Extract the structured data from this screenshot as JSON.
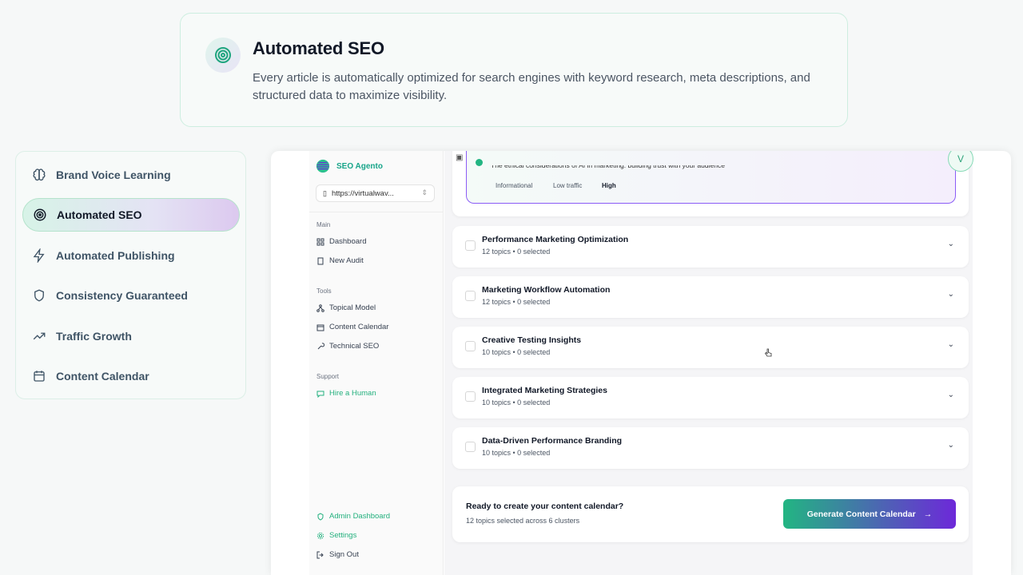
{
  "hero": {
    "title": "Automated SEO",
    "description": "Every article is automatically optimized for search engines with keyword research, meta descriptions, and structured data to maximize visibility.",
    "icon": "target-icon"
  },
  "features": [
    {
      "label": "Brand Voice Learning",
      "icon": "brain-icon",
      "active": false
    },
    {
      "label": "Automated SEO",
      "icon": "target-icon",
      "active": true
    },
    {
      "label": "Automated Publishing",
      "icon": "lightning-icon",
      "active": false
    },
    {
      "label": "Consistency Guaranteed",
      "icon": "shield-icon",
      "active": false
    },
    {
      "label": "Traffic Growth",
      "icon": "trending-up-icon",
      "active": false
    },
    {
      "label": "Content Calendar",
      "icon": "calendar-icon",
      "active": false
    }
  ],
  "app": {
    "brand": "SEO Agento",
    "site": "https://virtualwav...",
    "avatar": "V",
    "sections": {
      "main": "Main",
      "tools": "Tools",
      "support": "Support"
    },
    "nav": {
      "dashboard": "Dashboard",
      "new_audit": "New Audit",
      "topical_model": "Topical Model",
      "content_calendar": "Content Calendar",
      "technical_seo": "Technical SEO",
      "hire_human": "Hire a Human",
      "admin_dashboard": "Admin Dashboard",
      "settings": "Settings",
      "sign_out": "Sign Out"
    },
    "selected_topic": {
      "title": "The ethical considerations of AI in marketing: building trust with your audience",
      "tags": [
        "Informational",
        "Low traffic",
        "High"
      ]
    },
    "clusters": [
      {
        "title": "Performance Marketing Optimization",
        "meta": "12 topics • 0 selected"
      },
      {
        "title": "Marketing Workflow Automation",
        "meta": "12 topics • 0 selected"
      },
      {
        "title": "Creative Testing Insights",
        "meta": "10 topics • 0 selected"
      },
      {
        "title": "Integrated Marketing Strategies",
        "meta": "10 topics • 0 selected"
      },
      {
        "title": "Data-Driven Performance Branding",
        "meta": "10 topics • 0 selected"
      }
    ],
    "cta": {
      "title": "Ready to create your content calendar?",
      "subtitle": "12 topics selected across 6 clusters",
      "button": "Generate Content Calendar",
      "button_arrow": "→"
    }
  },
  "colors": {
    "accent_green": "#22b582",
    "accent_purple": "#6d28d9"
  }
}
